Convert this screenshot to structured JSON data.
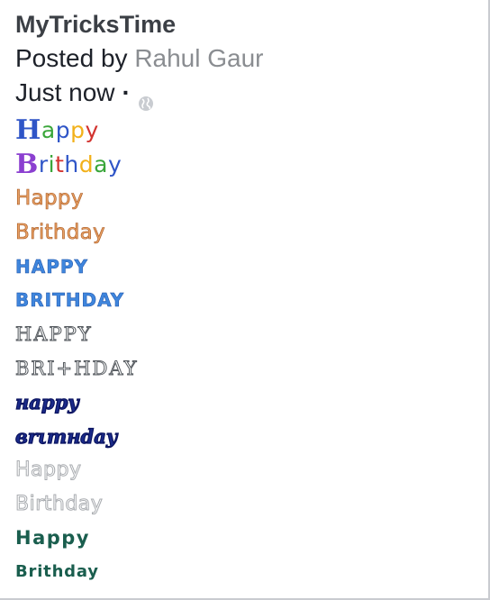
{
  "post": {
    "page_name": "MyTricksTime",
    "posted_by_prefix": "Posted by",
    "author": "Rahul Gaur",
    "time": "Just now",
    "separator": "·",
    "privacy_icon": "globe-icon"
  },
  "styled_text": {
    "line1": {
      "cap": "H",
      "rest": [
        "a",
        "p",
        "p",
        "y"
      ]
    },
    "line2": {
      "cap": "B",
      "rest": [
        "r",
        "i",
        "t",
        "h",
        "d",
        "a",
        "y"
      ]
    },
    "line3": "Happy",
    "line4": "Brithday",
    "line5": "HAPPY",
    "line6": "BRITHDAY",
    "line7": "HAPPY",
    "line8": "BRI+HDAY",
    "line9": "нappy",
    "line10": "вrιтнday",
    "line11": "Happy",
    "line12": "Birthday",
    "line13": "Happy",
    "line14": "Brithday"
  },
  "colors": {
    "line1_cap": "#2f55c7",
    "line1_letters": [
      "#3aa63a",
      "#2f55c7",
      "#f2b11a",
      "#d2332f"
    ],
    "line2_cap": "#8b3fd0",
    "line2_letters": [
      "#2f55c7",
      "#3aa63a",
      "#d2332f",
      "#2f55c7",
      "#f2b11a",
      "#3aa63a",
      "#2f55c7"
    ]
  }
}
